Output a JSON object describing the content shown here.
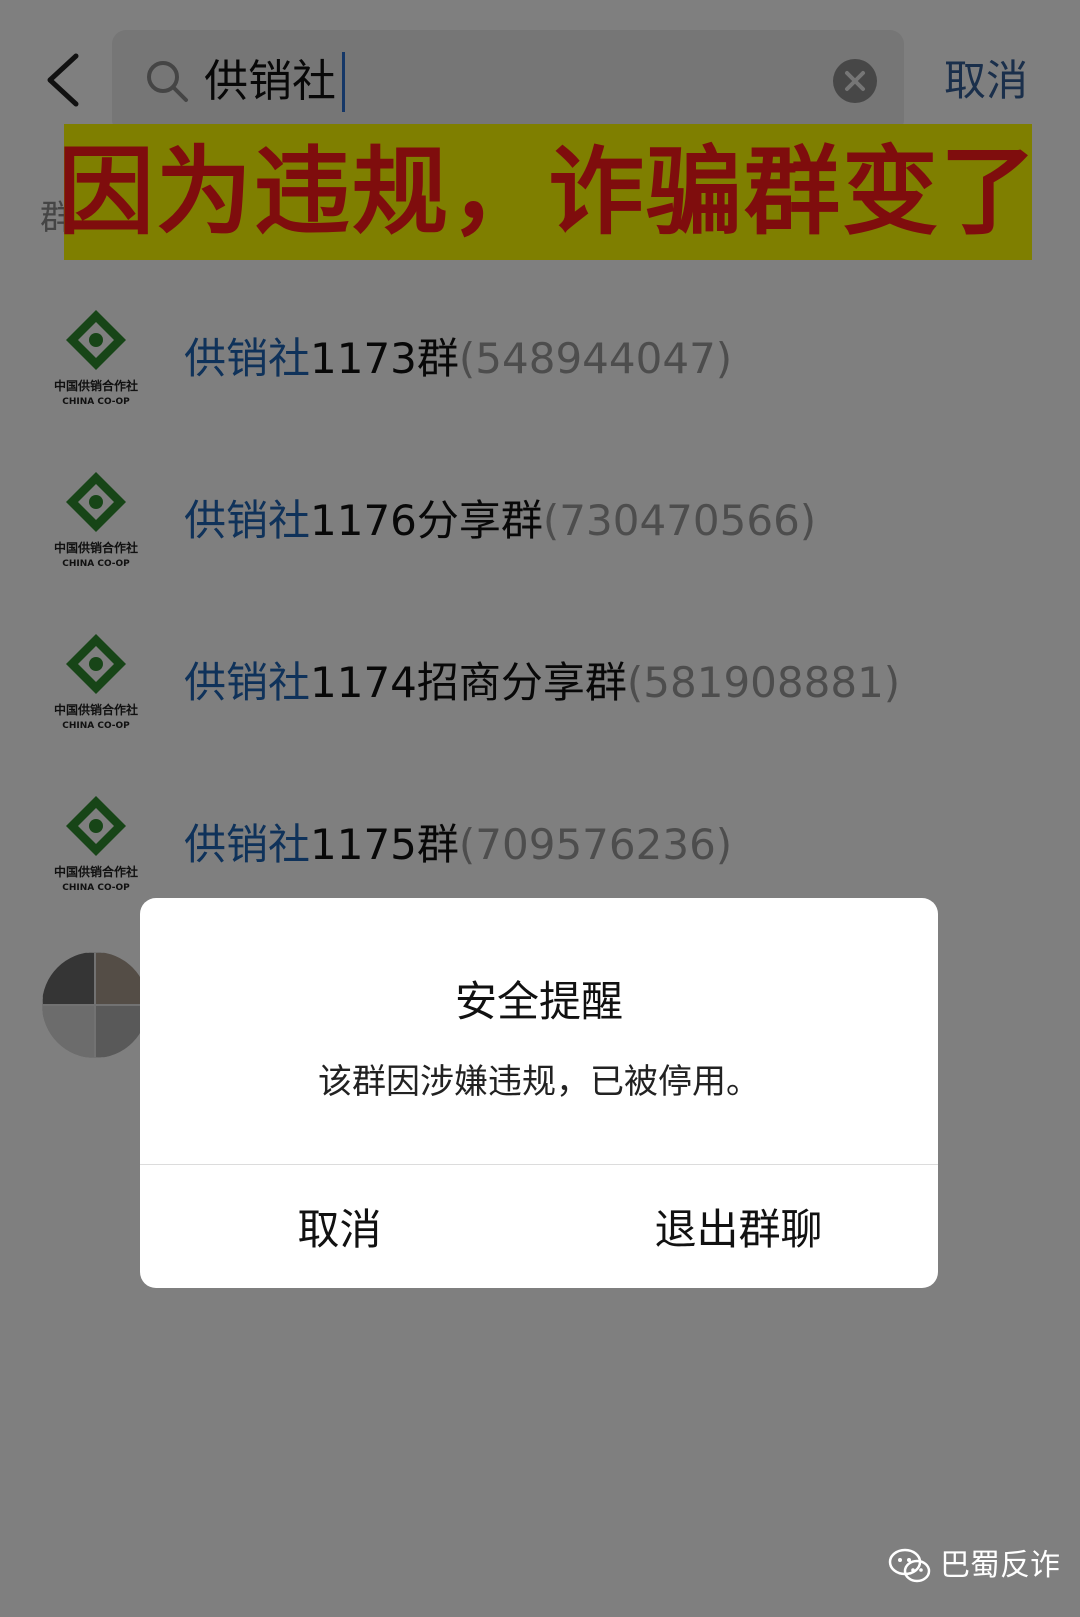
{
  "search": {
    "query": "供销社",
    "cancel_label": "取消"
  },
  "banner": {
    "text": "因为违规，诈骗群变了"
  },
  "section": {
    "label": "群"
  },
  "results": [
    {
      "keyword": "供销社",
      "suffix": "1173群",
      "number": "(548944047)"
    },
    {
      "keyword": "供销社",
      "suffix": "1176分享群",
      "number": "(730470566)"
    },
    {
      "keyword": "供销社",
      "suffix": "1174招商分享群",
      "number": "(581908881)"
    },
    {
      "keyword": "供销社",
      "suffix": "1175群",
      "number": "(709576236)"
    }
  ],
  "logo": {
    "cn_text": "中国供销合作社",
    "en_text": "CHINA CO-OP",
    "color": "#2e8b2e"
  },
  "dialog": {
    "title": "安全提醒",
    "message": "该群因涉嫌违规，已被停用。",
    "cancel_label": "取消",
    "exit_label": "退出群聊"
  },
  "watermark": {
    "text": "巴蜀反诈"
  },
  "colors": {
    "keyword": "#1e64b4",
    "banner_bg": "#ffff00",
    "banner_text": "#ff1a1a",
    "overlay": "rgba(0,0,0,0.5)"
  }
}
